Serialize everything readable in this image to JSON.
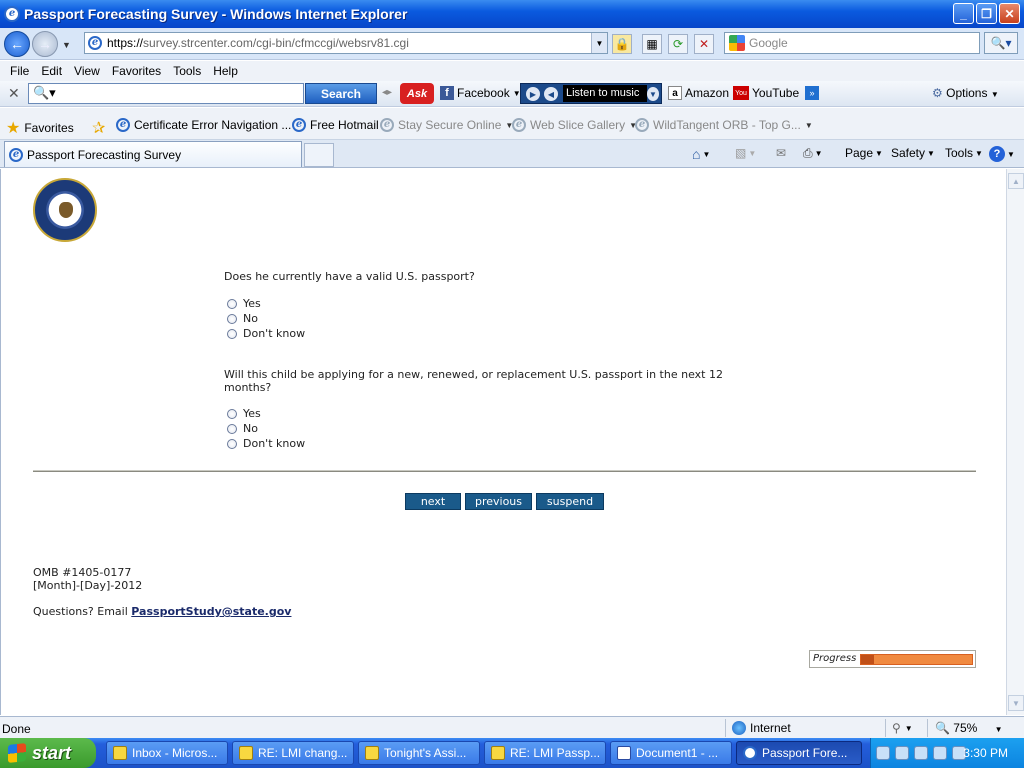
{
  "window": {
    "title": "Passport Forecasting Survey - Windows Internet Explorer",
    "minimize": "_",
    "maximize": "❐",
    "close": "✕"
  },
  "address": {
    "url_prefix": "https://",
    "url_host": "survey.strcenter.com",
    "url_path": "/cgi-bin/cfmccgi/websrv81.cgi",
    "search_placeholder": "Google"
  },
  "menu": [
    "File",
    "Edit",
    "View",
    "Favorites",
    "Tools",
    "Help"
  ],
  "ask_toolbar": {
    "search_label": "Search",
    "ask_logo": "Ask",
    "facebook": "Facebook",
    "music": "Listen to music",
    "amazon": "Amazon",
    "youtube": "YouTube",
    "options": "Options"
  },
  "favorites": {
    "label": "Favorites",
    "items": [
      {
        "label": "Certificate Error Navigation ..."
      },
      {
        "label": "Free Hotmail"
      },
      {
        "label": "Stay Secure Online"
      },
      {
        "label": "Web Slice Gallery"
      },
      {
        "label": "WildTangent ORB - Top G..."
      }
    ]
  },
  "tab": {
    "label": "Passport Forecasting Survey"
  },
  "command_bar": {
    "page": "Page",
    "safety": "Safety",
    "tools": "Tools",
    "help": "?"
  },
  "survey": {
    "q1": {
      "text": "Does he currently have a valid U.S. passport?",
      "options": [
        "Yes",
        "No",
        "Don't know"
      ]
    },
    "q2": {
      "text": "Will this child be applying for a new, renewed, or replacement U.S. passport in the next 12 months?",
      "options": [
        "Yes",
        "No",
        "Don't know"
      ]
    },
    "buttons": {
      "next": "next",
      "previous": "previous",
      "suspend": "suspend"
    },
    "omb": "OMB #1405-0177",
    "date": "[Month]-[Day]-2012",
    "questions_prefix": "Questions? Email ",
    "email": "PassportStudy@state.gov",
    "progress_label": "Progress",
    "progress_fraction": 0.12
  },
  "status": {
    "text": "Done",
    "zone": "Internet",
    "zoom": "75%"
  },
  "taskbar": {
    "start": "start",
    "items": [
      {
        "label": "Inbox - Micros..."
      },
      {
        "label": "RE: LMI chang..."
      },
      {
        "label": "Tonight's Assi..."
      },
      {
        "label": "RE: LMI Passp..."
      },
      {
        "label": "Document1 - ..."
      },
      {
        "label": "Passport Fore..."
      }
    ],
    "clock": "3:30 PM"
  }
}
